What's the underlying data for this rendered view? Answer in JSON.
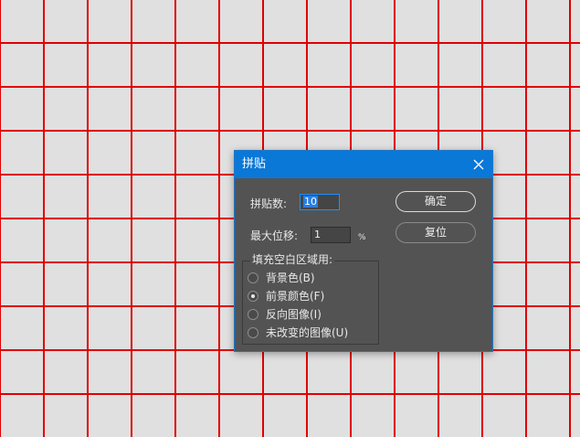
{
  "dialog": {
    "title": "拼贴",
    "close_icon": "close-icon",
    "tiles": {
      "label": "拼贴数:",
      "value": "10"
    },
    "max_offset": {
      "label": "最大位移:",
      "value": "1",
      "unit": "%"
    },
    "fill_group": {
      "legend": "填充空白区域用:",
      "options": [
        {
          "label": "背景色(B)",
          "selected": false
        },
        {
          "label": "前景颜色(F)",
          "selected": true
        },
        {
          "label": "反向图像(I)",
          "selected": false
        },
        {
          "label": "未改变的图像(U)",
          "selected": false
        }
      ]
    },
    "ok_label": "确定",
    "reset_label": "复位"
  },
  "colors": {
    "canvas_background": "#e0e0e0",
    "grid_lines": "#e00000",
    "titlebar": "#0a78d7",
    "dialog_body": "#535353"
  }
}
